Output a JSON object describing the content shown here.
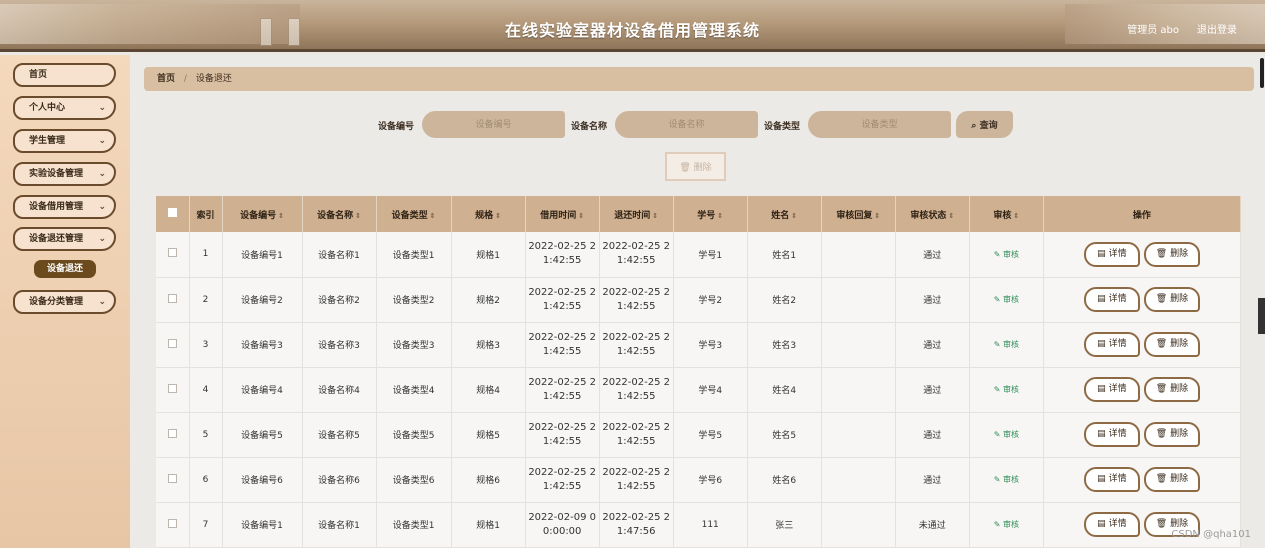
{
  "header": {
    "title": "在线实验室器材设备借用管理系统",
    "user": "管理员 abo",
    "logout": "退出登录"
  },
  "sidebar": {
    "items": [
      {
        "label": "首页",
        "chevron": ""
      },
      {
        "label": "个人中心",
        "chevron": "⌄"
      },
      {
        "label": "学生管理",
        "chevron": "⌄"
      },
      {
        "label": "实验设备管理",
        "chevron": "⌄"
      },
      {
        "label": "设备借用管理",
        "chevron": "⌄"
      },
      {
        "label": "设备退还管理",
        "chevron": "⌄"
      },
      {
        "label": "设备分类管理",
        "chevron": "⌄"
      }
    ],
    "active_sub": "设备退还"
  },
  "breadcrumb": {
    "home": "首页",
    "sep": "/",
    "current": "设备退还"
  },
  "search": {
    "no_label": "设备编号",
    "no_placeholder": "设备编号",
    "name_label": "设备名称",
    "name_placeholder": "设备名称",
    "type_label": "设备类型",
    "type_placeholder": "设备类型",
    "query_btn": "查询"
  },
  "actions": {
    "delete_btn": "删除"
  },
  "table": {
    "headers": [
      "索引",
      "设备编号",
      "设备名称",
      "设备类型",
      "规格",
      "借用时间",
      "退还时间",
      "学号",
      "姓名",
      "审核回复",
      "审核状态",
      "审核",
      "操作"
    ],
    "audit_label": "审核",
    "detail_label": "详情",
    "delete_label": "删除",
    "rows": [
      {
        "index": "1",
        "no": "设备编号1",
        "name": "设备名称1",
        "type": "设备类型1",
        "spec": "规格1",
        "borrow1": "2022-02-25 2",
        "borrow2": "1:42:55",
        "return1": "2022-02-25 2",
        "return2": "1:42:55",
        "sid": "学号1",
        "sname": "姓名1",
        "reply": "",
        "status": "通过"
      },
      {
        "index": "2",
        "no": "设备编号2",
        "name": "设备名称2",
        "type": "设备类型2",
        "spec": "规格2",
        "borrow1": "2022-02-25 2",
        "borrow2": "1:42:55",
        "return1": "2022-02-25 2",
        "return2": "1:42:55",
        "sid": "学号2",
        "sname": "姓名2",
        "reply": "",
        "status": "通过"
      },
      {
        "index": "3",
        "no": "设备编号3",
        "name": "设备名称3",
        "type": "设备类型3",
        "spec": "规格3",
        "borrow1": "2022-02-25 2",
        "borrow2": "1:42:55",
        "return1": "2022-02-25 2",
        "return2": "1:42:55",
        "sid": "学号3",
        "sname": "姓名3",
        "reply": "",
        "status": "通过"
      },
      {
        "index": "4",
        "no": "设备编号4",
        "name": "设备名称4",
        "type": "设备类型4",
        "spec": "规格4",
        "borrow1": "2022-02-25 2",
        "borrow2": "1:42:55",
        "return1": "2022-02-25 2",
        "return2": "1:42:55",
        "sid": "学号4",
        "sname": "姓名4",
        "reply": "",
        "status": "通过"
      },
      {
        "index": "5",
        "no": "设备编号5",
        "name": "设备名称5",
        "type": "设备类型5",
        "spec": "规格5",
        "borrow1": "2022-02-25 2",
        "borrow2": "1:42:55",
        "return1": "2022-02-25 2",
        "return2": "1:42:55",
        "sid": "学号5",
        "sname": "姓名5",
        "reply": "",
        "status": "通过"
      },
      {
        "index": "6",
        "no": "设备编号6",
        "name": "设备名称6",
        "type": "设备类型6",
        "spec": "规格6",
        "borrow1": "2022-02-25 2",
        "borrow2": "1:42:55",
        "return1": "2022-02-25 2",
        "return2": "1:42:55",
        "sid": "学号6",
        "sname": "姓名6",
        "reply": "",
        "status": "通过"
      },
      {
        "index": "7",
        "no": "设备编号1",
        "name": "设备名称1",
        "type": "设备类型1",
        "spec": "规格1",
        "borrow1": "2022-02-09 0",
        "borrow2": "0:00:00",
        "return1": "2022-02-25 2",
        "return2": "1:47:56",
        "sid": "111",
        "sname": "张三",
        "reply": "",
        "status": "未通过"
      }
    ]
  },
  "watermark": "CSDN @qha101"
}
